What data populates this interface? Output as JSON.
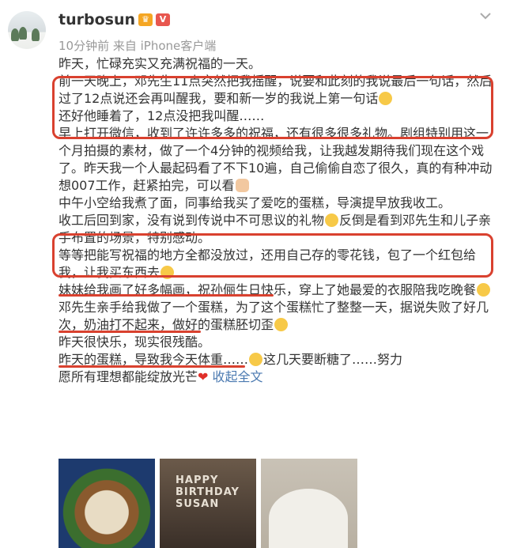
{
  "user": {
    "name": "turbosun",
    "meta": "10分钟前  来自 iPhone客户端"
  },
  "post": {
    "lines": [
      "昨天，忙碌充实又充满祝福的一天。",
      "前一天晚上，邓先生11点突然把我摇醒，说要和此刻的我说最后一句话，然后过了12点说还会再叫醒我，要和新一岁的我说上第一句话",
      "还好他睡着了，12点没把我叫醒……",
      "早上打开微信，收到了许许多多的祝福，还有很多很多礼物。剧组特别用这一个月拍摄的素材，做了一个4分钟的视频给我，让我越发期待我们现在这个戏了。昨天我一个人最起码看了不下10遍，自己偷偷自恋了很久，真的有种冲动想007工作，赶紧拍完，可以看",
      "中午小空给我煮了面，同事给我买了爱吃的蛋糕，导演提早放我收工。",
      "收工后回到家，没有说到传说中不可思议的礼物",
      "反倒是看到邓先生和儿子亲手布置的场景，特别感动。",
      "等等把能写祝福的地方全都没放过，还用自己存的零花钱，包了一个红包给我，让我买东西去",
      "妹妹给我画了好多幅画，祝孙俪生日快乐，穿上了她最爱的衣服陪我吃晚餐",
      "邓先生亲手给我做了一个蛋糕，为了这个蛋糕忙了整整一天，据说失败了好几次，奶油打不起来，做好的蛋糕胚切歪",
      "昨天很快乐，现实很残酷。",
      "昨天的蛋糕，导致我今天体重……",
      "这几天要断糖了……努力",
      "愿所有理想都能绽放光芒"
    ],
    "collapse": "收起全文",
    "heart": "❤"
  },
  "photos": {
    "card_text": "HAPPY BIRTHDAY SUSAN"
  }
}
